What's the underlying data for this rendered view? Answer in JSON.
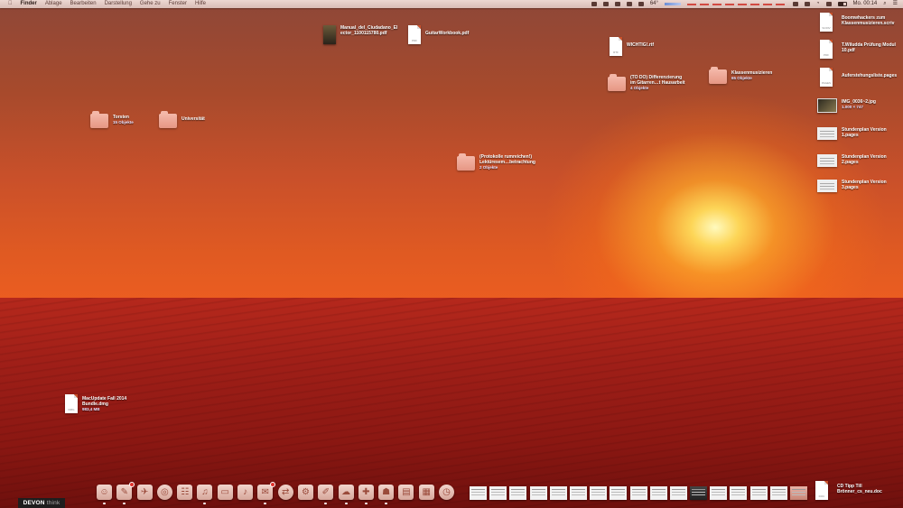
{
  "menubar": {
    "apple": "",
    "menus": [
      "Finder",
      "Ablage",
      "Bearbeiten",
      "Darstellung",
      "Gehe zu",
      "Fenster",
      "Hilfe"
    ],
    "status": {
      "temperature": "64°",
      "clock": "Mo. 00:14"
    }
  },
  "desktop_icons": [
    {
      "id": "manual",
      "kind": "pdfbook",
      "line1": "Manual_del_Ciudadano_El",
      "line2": "ector_1100115780.pdf",
      "sub": ""
    },
    {
      "id": "guitar",
      "kind": "doc",
      "ext": "PDF",
      "line1": "GuitarWorkbook.pdf",
      "line2": "",
      "sub": ""
    },
    {
      "id": "wichtig",
      "kind": "doc",
      "ext": "RTF",
      "line1": "WICHTIG!.rtf",
      "line2": "",
      "sub": ""
    },
    {
      "id": "todo",
      "kind": "folder",
      "line1": "(TO DO) Differenzierung",
      "line2": "im Gitarren…t Hausarbeit",
      "sub": "4 Objekte"
    },
    {
      "id": "klassen",
      "kind": "folder",
      "line1": "Klassenmusizieren",
      "line2": "",
      "sub": "65 Objekte"
    },
    {
      "id": "torsten",
      "kind": "folder",
      "line1": "Torsten",
      "line2": "",
      "sub": "15 Objekte"
    },
    {
      "id": "uni",
      "kind": "folder",
      "line1": "Universität",
      "line2": "",
      "sub": ""
    },
    {
      "id": "protokolle",
      "kind": "folder",
      "line1": "(Protokolle rumreichen!)",
      "line2": "Lektüresem…betrachtung",
      "sub": "2 Objekte"
    },
    {
      "id": "macupdate",
      "kind": "doc",
      "ext": "DMG",
      "line1": "MacUpdate Fall 2014",
      "line2": "Bundle.dmg",
      "sub": "983,4 MB"
    },
    {
      "id": "boomwhackers",
      "kind": "doc",
      "ext": "SCRIV",
      "line1": "Boomwhackers zum",
      "line2": "Klassenmusizieren.scriv",
      "sub": ""
    },
    {
      "id": "tprufung",
      "kind": "doc",
      "ext": "PDF",
      "line1": "T.Wiludda Prüfung Modul",
      "line2": "10.pdf",
      "sub": ""
    },
    {
      "id": "auferstehung",
      "kind": "doc",
      "ext": "PAGES",
      "line1": "Auferstehungsliste.pages",
      "line2": "",
      "sub": ""
    },
    {
      "id": "img",
      "kind": "photo",
      "line1": "IMG_0036~2.jpg",
      "line2": "",
      "sub": "1.000 × 747"
    },
    {
      "id": "stunden1",
      "kind": "thumb",
      "line1": "Stundenplan Version",
      "line2": "1.pages",
      "sub": ""
    },
    {
      "id": "stunden2",
      "kind": "thumb",
      "line1": "Stundenplan Version",
      "line2": "2.pages",
      "sub": ""
    },
    {
      "id": "stunden3",
      "kind": "thumb",
      "line1": "Stundenplan Version",
      "line2": "3.pages",
      "sub": ""
    },
    {
      "id": "cdtipp",
      "kind": "doc",
      "ext": "DOC",
      "line1": "CD Tipp Till",
      "line2": "Brönner_cs_neu.doc",
      "sub": ""
    }
  ],
  "dock": {
    "apps": [
      {
        "name": "finder",
        "glyph": "☺",
        "badge": false,
        "running": true
      },
      {
        "name": "pages",
        "glyph": "✎",
        "badge": true,
        "running": true
      },
      {
        "name": "launchpad",
        "glyph": "✈",
        "badge": false,
        "running": false
      },
      {
        "name": "safari",
        "glyph": "◎",
        "badge": false,
        "running": false
      },
      {
        "name": "contacts",
        "glyph": "☷",
        "badge": false,
        "running": false
      },
      {
        "name": "itunes",
        "glyph": "♫",
        "badge": false,
        "running": true
      },
      {
        "name": "preview",
        "glyph": "▭",
        "badge": false,
        "running": false
      },
      {
        "name": "mic",
        "glyph": "♪",
        "badge": false,
        "running": false
      },
      {
        "name": "mail",
        "glyph": "✉",
        "badge": true,
        "running": true
      },
      {
        "name": "sync",
        "glyph": "⇄",
        "badge": false,
        "running": false
      },
      {
        "name": "settings",
        "glyph": "⚙",
        "badge": false,
        "running": false
      },
      {
        "name": "notes",
        "glyph": "✐",
        "badge": false,
        "running": true
      },
      {
        "name": "messages",
        "glyph": "☁",
        "badge": false,
        "running": true
      },
      {
        "name": "shield",
        "glyph": "✚",
        "badge": false,
        "running": true
      },
      {
        "name": "library",
        "glyph": "☗",
        "badge": false,
        "running": true
      },
      {
        "name": "archive",
        "glyph": "▤",
        "badge": false,
        "running": false
      },
      {
        "name": "calculator",
        "glyph": "▦",
        "badge": false,
        "running": false
      },
      {
        "name": "clock",
        "glyph": "◷",
        "badge": false,
        "running": false
      }
    ],
    "minimized_windows": 17,
    "devon": {
      "brand": "DEVON",
      "suffix": "think"
    }
  }
}
